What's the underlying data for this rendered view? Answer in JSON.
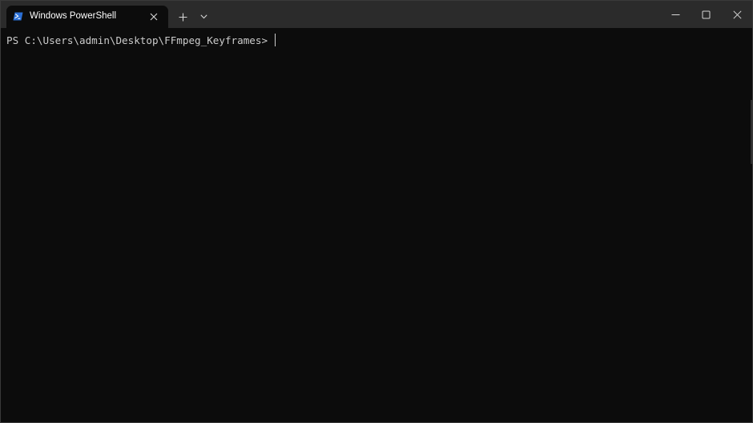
{
  "window": {
    "tab": {
      "title": "Windows PowerShell",
      "icon": "powershell-icon"
    },
    "controls": {
      "close_tab_icon": "close-icon",
      "new_tab_icon": "plus-icon",
      "dropdown_icon": "chevron-down-icon",
      "minimize_icon": "minimize-icon",
      "maximize_icon": "maximize-icon",
      "close_window_icon": "close-icon"
    }
  },
  "terminal": {
    "prompt": "PS C:\\Users\\admin\\Desktop\\FFmpeg_Keyframes> ",
    "input": ""
  },
  "colors": {
    "titlebar": "#2b2b2b",
    "background": "#0c0c0c",
    "text": "#cccccc",
    "powershell_blue": "#2a6fd6"
  }
}
